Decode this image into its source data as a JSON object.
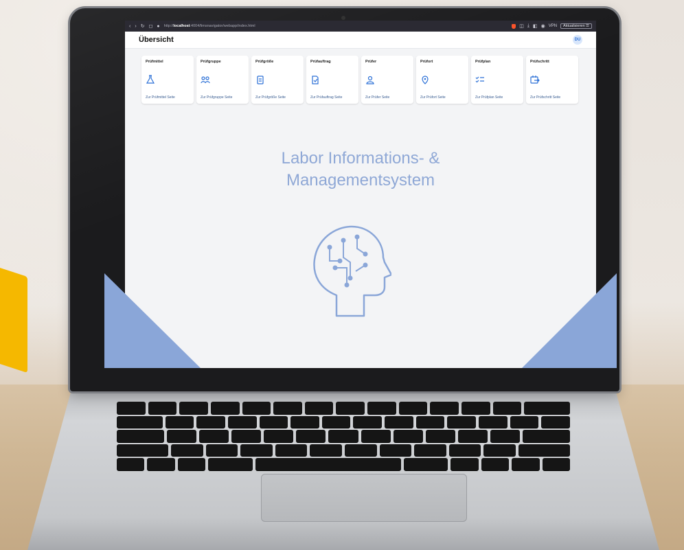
{
  "browser": {
    "url_prefix": "http://",
    "url_host": "localhost",
    "url_rest": ":4004/limsnavigator/webapp/index.html",
    "vpn_label": "VPN",
    "update_label": "Aktualisieren"
  },
  "app": {
    "title": "Übersicht",
    "avatar_initials": "DU"
  },
  "tiles": [
    {
      "title": "Prüfmittel",
      "link": "Zur Prüfmittel Seite",
      "icon": "flask-icon"
    },
    {
      "title": "Prüfgruppe",
      "link": "Zur Prüfgruppe Seite",
      "icon": "group-icon"
    },
    {
      "title": "Prüfgröße",
      "link": "Zur Prüfgröße Seite",
      "icon": "clipboard-icon"
    },
    {
      "title": "Prüfauftrag",
      "link": "Zur Prüfauftrag Seite",
      "icon": "task-icon"
    },
    {
      "title": "Prüfer",
      "link": "Zur Prüfer Seite",
      "icon": "person-icon"
    },
    {
      "title": "Prüfort",
      "link": "Zur Prüfort Seite",
      "icon": "location-icon"
    },
    {
      "title": "Prüfplan",
      "link": "Zur Prüfplan Seite",
      "icon": "checklist-icon"
    },
    {
      "title": "Prüfschritt",
      "link": "Zur Prüfschritt Seite",
      "icon": "step-icon"
    }
  ],
  "hero": {
    "line1": "Labor Informations- &",
    "line2": "Managementsystem"
  },
  "colors": {
    "accent": "#8aa6d8",
    "icon_blue": "#2a6fd6",
    "hero_text": "#8fa8d6"
  }
}
